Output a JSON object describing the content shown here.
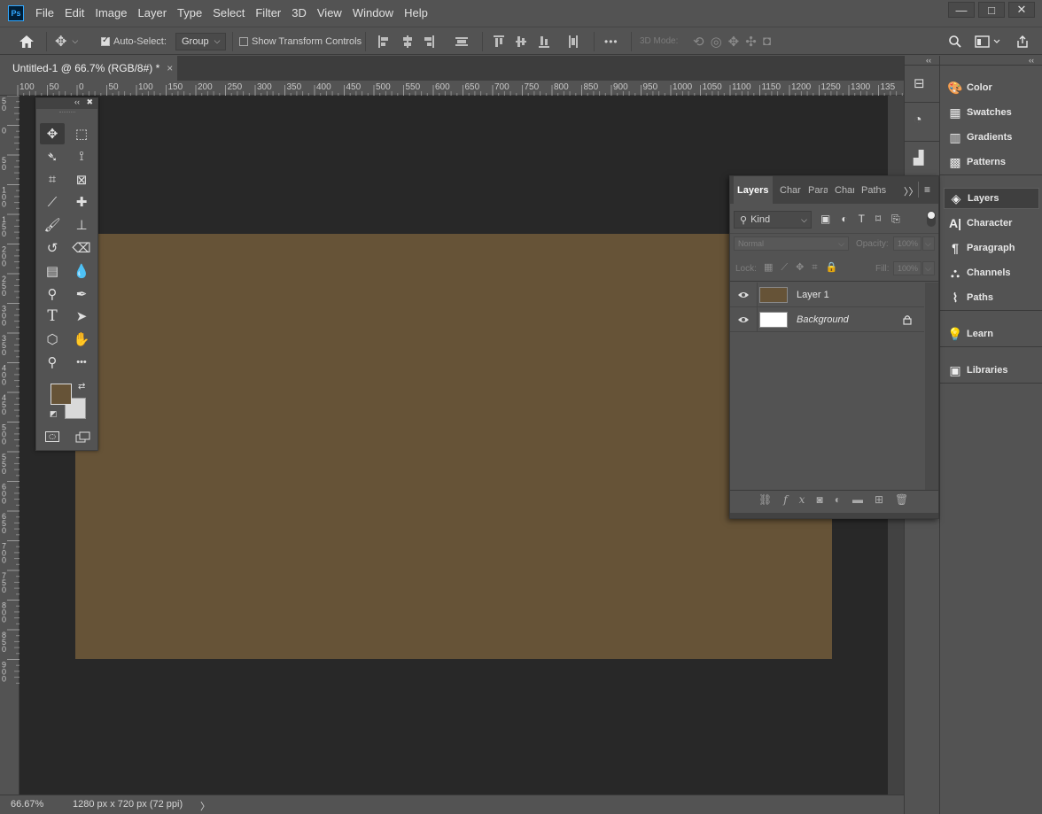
{
  "app": {
    "logo": "Ps"
  },
  "menu": [
    "File",
    "Edit",
    "Image",
    "Layer",
    "Type",
    "Select",
    "Filter",
    "3D",
    "View",
    "Window",
    "Help"
  ],
  "window_controls": {
    "minimize": "—",
    "maximize": "□",
    "close": "✕"
  },
  "options_bar": {
    "auto_select_label": "Auto-Select:",
    "auto_select_checked": true,
    "group_value": "Group",
    "show_transform_label": "Show Transform Controls",
    "mode_3d_label": "3D Mode:",
    "more_label": "•••"
  },
  "document_tab": {
    "title": "Untitled-1 @ 66.7% (RGB/8#) *",
    "close": "×"
  },
  "ruler_h_labels": [
    "100",
    "50",
    "0",
    "50",
    "100",
    "150",
    "200",
    "250",
    "300",
    "350",
    "400",
    "450",
    "500",
    "550",
    "600",
    "650",
    "700",
    "750",
    "800",
    "850",
    "900",
    "950",
    "1000",
    "1050",
    "1100",
    "1150",
    "1200",
    "1250",
    "1300",
    "135"
  ],
  "ruler_v_labels": [
    "5 0",
    "0",
    "5 0",
    "1 0 0",
    "1 5 0",
    "2 0 0",
    "2 5 0",
    "3 0 0",
    "3 5 0",
    "4 0 0",
    "4 5 0",
    "5 0 0",
    "5 5 0",
    "6 0 0",
    "6 5 0",
    "7 0 0",
    "7 5 0",
    "8 0 0",
    "8 5 0",
    "9 0 0"
  ],
  "canvas": {
    "fill_color": "#665337",
    "workspace_color": "#282828"
  },
  "status": {
    "zoom": "66.67%",
    "doc_info": "1280 px x 720 px (72 ppi)",
    "arrow": "〉"
  },
  "toolbox": {
    "foreground_color": "#665337",
    "background_color": "#d9d9d9",
    "tools": [
      {
        "name": "move-icon",
        "glyph": "✥",
        "active": true
      },
      {
        "name": "marquee-icon",
        "glyph": "⬚"
      },
      {
        "name": "lasso-icon",
        "glyph": "➴"
      },
      {
        "name": "quick-select-icon",
        "glyph": "⟟"
      },
      {
        "name": "crop-icon",
        "glyph": "⌗"
      },
      {
        "name": "frame-icon",
        "glyph": "⊠"
      },
      {
        "name": "eyedropper-icon",
        "glyph": "⟋"
      },
      {
        "name": "healing-icon",
        "glyph": "✚"
      },
      {
        "name": "brush-icon",
        "glyph": "🖌"
      },
      {
        "name": "stamp-icon",
        "glyph": "⊥"
      },
      {
        "name": "history-brush-icon",
        "glyph": "↺"
      },
      {
        "name": "eraser-icon",
        "glyph": "⌫"
      },
      {
        "name": "gradient-icon",
        "glyph": "▤"
      },
      {
        "name": "blur-icon",
        "glyph": "💧"
      },
      {
        "name": "dodge-icon",
        "glyph": "⚲"
      },
      {
        "name": "pen-icon",
        "glyph": "✒"
      },
      {
        "name": "type-icon",
        "glyph": "T"
      },
      {
        "name": "path-select-icon",
        "glyph": "➤"
      },
      {
        "name": "shape-icon",
        "glyph": "⬡"
      },
      {
        "name": "hand-icon",
        "glyph": "✋"
      },
      {
        "name": "zoom-icon",
        "glyph": "⚲"
      },
      {
        "name": "more-tools-icon",
        "glyph": "•••"
      }
    ]
  },
  "right_panel": {
    "items": [
      {
        "label": "Color",
        "icon": "palette-icon",
        "glyph": "🎨"
      },
      {
        "label": "Swatches",
        "icon": "swatches-icon",
        "glyph": "▦"
      },
      {
        "label": "Gradients",
        "icon": "gradients-icon",
        "glyph": "▥"
      },
      {
        "label": "Patterns",
        "icon": "patterns-icon",
        "glyph": "▩"
      },
      {
        "label": "Layers",
        "icon": "layers-icon",
        "glyph": "◈",
        "active": true
      },
      {
        "label": "Character",
        "icon": "character-icon",
        "glyph": "A|"
      },
      {
        "label": "Paragraph",
        "icon": "paragraph-icon",
        "glyph": "¶"
      },
      {
        "label": "Channels",
        "icon": "channels-icon",
        "glyph": "⛬"
      },
      {
        "label": "Paths",
        "icon": "paths-icon",
        "glyph": "⌇"
      },
      {
        "label": "Learn",
        "icon": "learn-icon",
        "glyph": "💡"
      },
      {
        "label": "Libraries",
        "icon": "libraries-icon",
        "glyph": "▣"
      }
    ]
  },
  "layers_panel": {
    "tabs": [
      "Layers",
      "Char",
      "Para",
      "Chan",
      "Paths"
    ],
    "kind_label": "Kind",
    "blend_mode": "Normal",
    "opacity_label": "Opacity:",
    "opacity_value": "100%",
    "lock_label": "Lock:",
    "fill_label": "Fill:",
    "fill_value": "100%",
    "layers": [
      {
        "name": "Layer 1",
        "thumb": "#665337",
        "italic": false,
        "locked": false
      },
      {
        "name": "Background",
        "thumb": "#ffffff",
        "italic": true,
        "locked": true
      }
    ]
  }
}
